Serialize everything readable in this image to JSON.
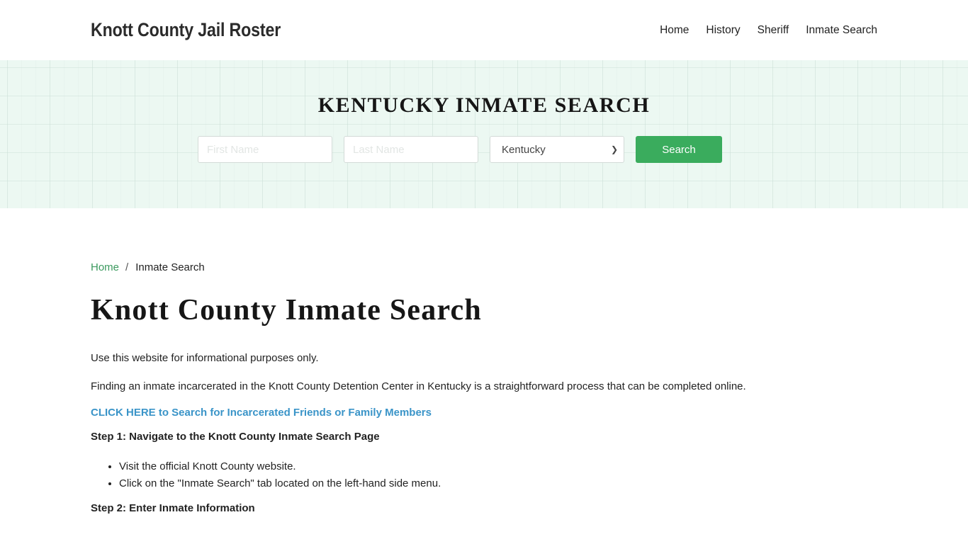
{
  "header": {
    "brand": "Knott County Jail Roster",
    "nav": [
      {
        "label": "Home"
      },
      {
        "label": "History"
      },
      {
        "label": "Sheriff"
      },
      {
        "label": "Inmate Search"
      }
    ]
  },
  "hero": {
    "title": "KENTUCKY INMATE SEARCH",
    "first_name_placeholder": "First Name",
    "last_name_placeholder": "Last Name",
    "state_selected": "Kentucky",
    "search_label": "Search",
    "accent": "#3aac5d"
  },
  "breadcrumb": {
    "home": "Home",
    "separator": "/",
    "current": "Inmate Search"
  },
  "main": {
    "title": "Knott County Inmate Search",
    "intro": "Use this website for informational purposes only.",
    "paragraph": "Finding an inmate incarcerated in the Knott County Detention Center in Kentucky is a straightforward process that can be completed online.",
    "cta": "CLICK HERE to Search for Incarcerated Friends or Family Members",
    "step1": "Step 1: Navigate to the Knott County Inmate Search Page",
    "step1_items": [
      "Visit the official Knott County website.",
      "Click on the \"Inmate Search\" tab located on the left-hand side menu."
    ],
    "step2": "Step 2: Enter Inmate Information"
  }
}
